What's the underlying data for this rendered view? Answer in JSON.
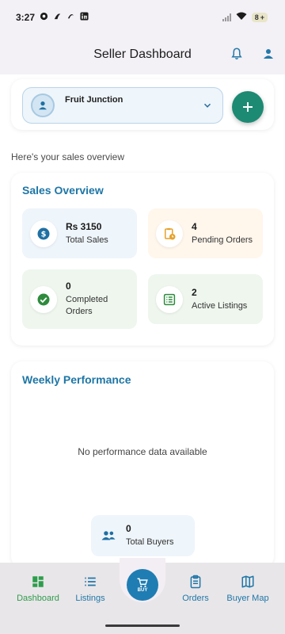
{
  "status": {
    "time": "3:27",
    "battery": "8"
  },
  "appbar": {
    "title": "Seller Dashboard",
    "icons": [
      "bell-icon",
      "person-icon"
    ]
  },
  "store": {
    "name": "Fruit Junction"
  },
  "greeting": "Here's your sales overview",
  "overview": {
    "title": "Sales Overview",
    "stats": [
      {
        "value": "Rs 3150",
        "label": "Total Sales",
        "icon": "dollar-icon",
        "bg": "#eef5fb",
        "accent": "#1f6fa3"
      },
      {
        "value": "4",
        "label": "Pending Orders",
        "icon": "clipboard-clock-icon",
        "bg": "#fff6ec",
        "accent": "#e6a12a"
      },
      {
        "value": "0",
        "label": "Completed Orders",
        "icon": "check-circle-icon",
        "bg": "#eef6ee",
        "accent": "#2e8b3d"
      },
      {
        "value": "2",
        "label": "Active Listings",
        "icon": "list-icon",
        "bg": "#eef6ee",
        "accent": "#2e8b3d"
      }
    ]
  },
  "performance": {
    "title": "Weekly Performance",
    "empty": "No performance data available",
    "buyers_value": "0",
    "buyers_label": "Total Buyers"
  },
  "nav": {
    "items": [
      {
        "label": "Dashboard",
        "icon": "dashboard-icon",
        "active": true
      },
      {
        "label": "Listings",
        "icon": "list-icon",
        "active": false
      },
      {
        "label": "Orders",
        "icon": "clipboard-icon",
        "active": false
      },
      {
        "label": "Buyer Map",
        "icon": "map-icon",
        "active": false
      }
    ],
    "buy_label": "BUY"
  },
  "colors": {
    "primary": "#1f76a8",
    "active": "#2d9d4c",
    "fab": "#1d8a73"
  }
}
